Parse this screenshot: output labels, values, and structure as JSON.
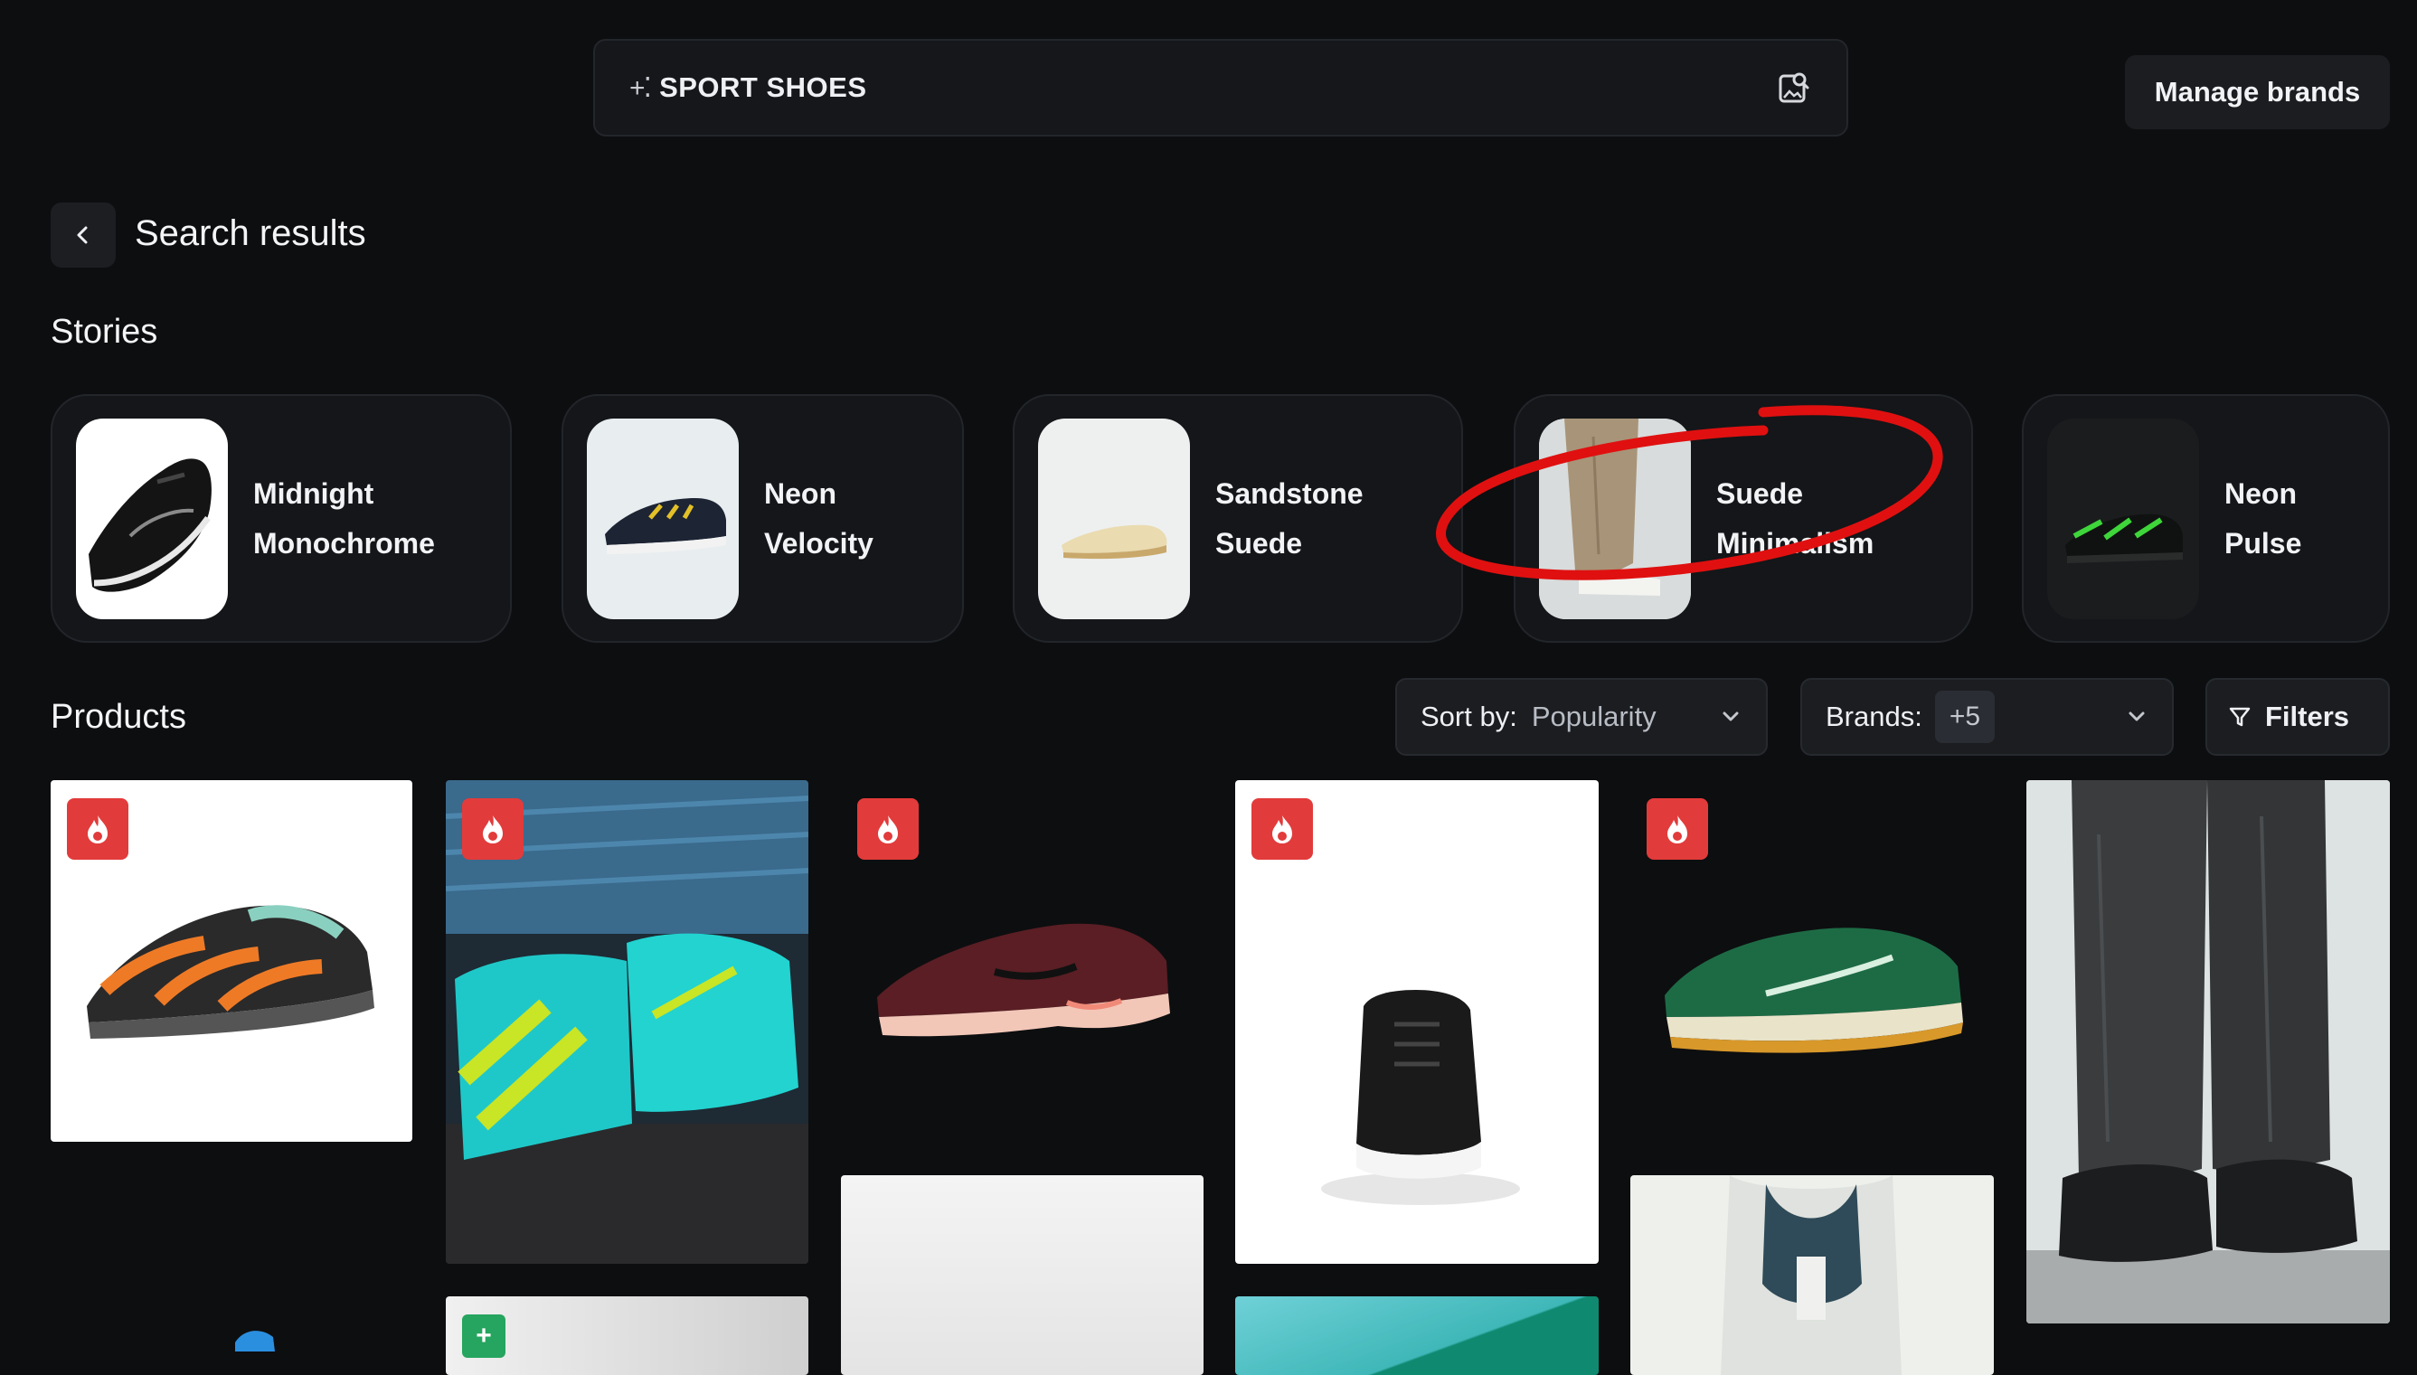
{
  "search": {
    "query": "SPORT SHOES"
  },
  "header": {
    "manage_brands": "Manage brands",
    "title": "Search results"
  },
  "stories": {
    "heading": "Stories",
    "items": [
      {
        "line1": "Midnight",
        "line2": "Monochrome"
      },
      {
        "line1": "Neon",
        "line2": "Velocity"
      },
      {
        "line1": "Sandstone",
        "line2": "Suede"
      },
      {
        "line1": "Suede",
        "line2": "Minimalism"
      },
      {
        "line1": "Neon",
        "line2": "Pulse"
      }
    ]
  },
  "products": {
    "heading": "Products",
    "sort_label": "Sort by:",
    "sort_value": "Popularity",
    "brands_label": "Brands:",
    "brands_count": "+5",
    "filters_label": "Filters"
  },
  "colors": {
    "background": "#0d0e10",
    "hot_badge": "#e23b3b",
    "new_badge": "#25a55f",
    "annotation": "#e01010"
  },
  "icons": [
    "sparkle-icon",
    "image-search-icon",
    "chevron-left-icon",
    "chevron-down-icon",
    "filter-icon",
    "flame-icon",
    "plus-icon"
  ]
}
